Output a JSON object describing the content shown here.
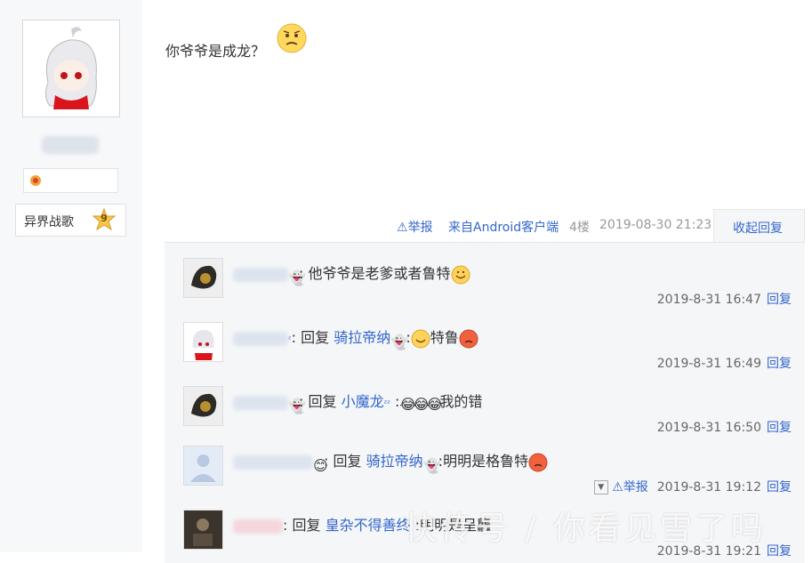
{
  "sidebar": {
    "forum_badge_name": "异界战歌",
    "forum_level": "9"
  },
  "post": {
    "text": "你爷爷是成龙？",
    "report": "举报",
    "source": "来自Android客户端",
    "floor": "4楼",
    "datetime": "2019-08-30 21:23",
    "collapse": "收起回复"
  },
  "replies": [
    {
      "pre": "",
      "target": "",
      "sep": "",
      "text": "他爷爷是老爹或者鲁特",
      "time": "2019-8-31 16:47",
      "reply": "回复"
    },
    {
      "pre": "回复 ",
      "target": "骑拉帝纳",
      "sep": " :",
      "text": "特鲁",
      "time": "2019-8-31 16:49",
      "reply": "回复"
    },
    {
      "pre": "回复 ",
      "target": "小魔龙",
      "sep": " :",
      "text": "我的错",
      "time": "2019-8-31 16:50",
      "reply": "回复"
    },
    {
      "pre": "回复 ",
      "target": "骑拉帝纳",
      "sep": " :",
      "text": "明明是格鲁特",
      "report": "举报",
      "time": "2019-8-31 19:12",
      "reply": "回复"
    },
    {
      "pre": "回复 ",
      "target": "皇杂不得善终",
      "sep": " :",
      "text": "明明是呈龘",
      "time": "2019-8-31 19:21",
      "reply": "回复"
    }
  ],
  "watermark": "快传号 / 你看见雪了吗",
  "colors": {
    "link": "#3366cc",
    "reply_bg": "#f5f6f8",
    "sidebar_bg": "#f7f8fa"
  }
}
